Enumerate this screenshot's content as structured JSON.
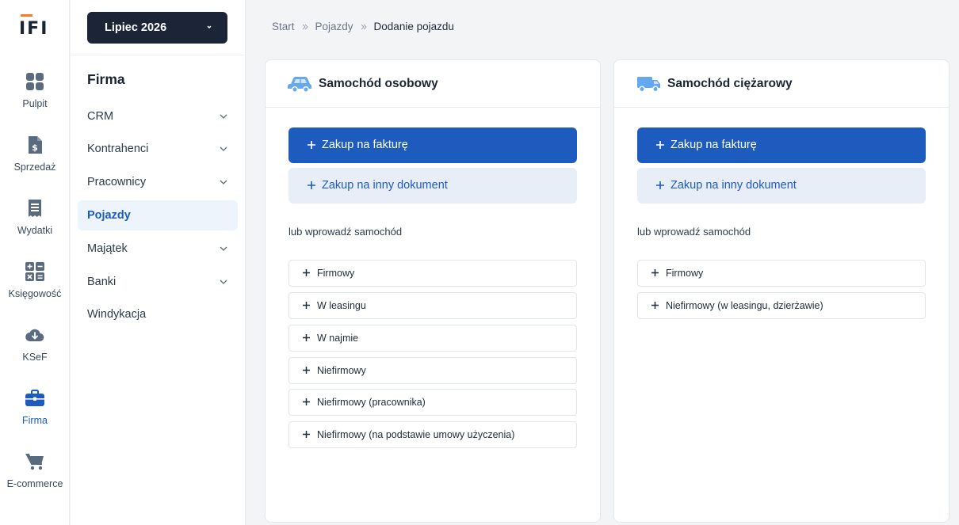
{
  "logo": {
    "text": "IFI"
  },
  "rail": {
    "items": [
      {
        "label": "Pulpit",
        "icon": "dashboard-icon"
      },
      {
        "label": "Sprzedaż",
        "icon": "invoice-dollar-icon"
      },
      {
        "label": "Wydatki",
        "icon": "receipt-icon"
      },
      {
        "label": "Księgowość",
        "icon": "calculator-icon"
      },
      {
        "label": "KSeF",
        "icon": "cloud-download-icon"
      },
      {
        "label": "Firma",
        "icon": "briefcase-icon",
        "active": true
      },
      {
        "label": "E-commerce",
        "icon": "cart-icon"
      }
    ]
  },
  "sidebar": {
    "period": "Lipiec 2026",
    "title": "Firma",
    "items": [
      {
        "label": "CRM",
        "expandable": true
      },
      {
        "label": "Kontrahenci",
        "expandable": true
      },
      {
        "label": "Pracownicy",
        "expandable": true
      },
      {
        "label": "Pojazdy",
        "expandable": false,
        "active": true
      },
      {
        "label": "Majątek",
        "expandable": true
      },
      {
        "label": "Banki",
        "expandable": true
      },
      {
        "label": "Windykacja",
        "expandable": false
      }
    ]
  },
  "breadcrumb": {
    "items": [
      "Start",
      "Pojazdy"
    ],
    "current": "Dodanie pojazdu"
  },
  "cards": {
    "passenger": {
      "title": "Samochód osobowy",
      "icon": "car-icon",
      "primary": "Zakup na fakturę",
      "secondary": "Zakup na inny dokument",
      "hint": "lub wprowadź samochód",
      "options": [
        "Firmowy",
        "W leasingu",
        "W najmie",
        "Niefirmowy",
        "Niefirmowy (pracownika)",
        "Niefirmowy (na podstawie umowy użyczenia)"
      ]
    },
    "truck": {
      "title": "Samochód ciężarowy",
      "icon": "truck-icon",
      "primary": "Zakup na fakturę",
      "secondary": "Zakup na inny dokument",
      "hint": "lub wprowadź samochód",
      "options": [
        "Firmowy",
        "Niefirmowy (w leasingu, dzierżawie)"
      ]
    }
  },
  "colors": {
    "accent": "#1d5bbf",
    "rail_icon": "#5b6b7f",
    "dark": "#1b2537",
    "logo_orange": "#f57c20"
  }
}
